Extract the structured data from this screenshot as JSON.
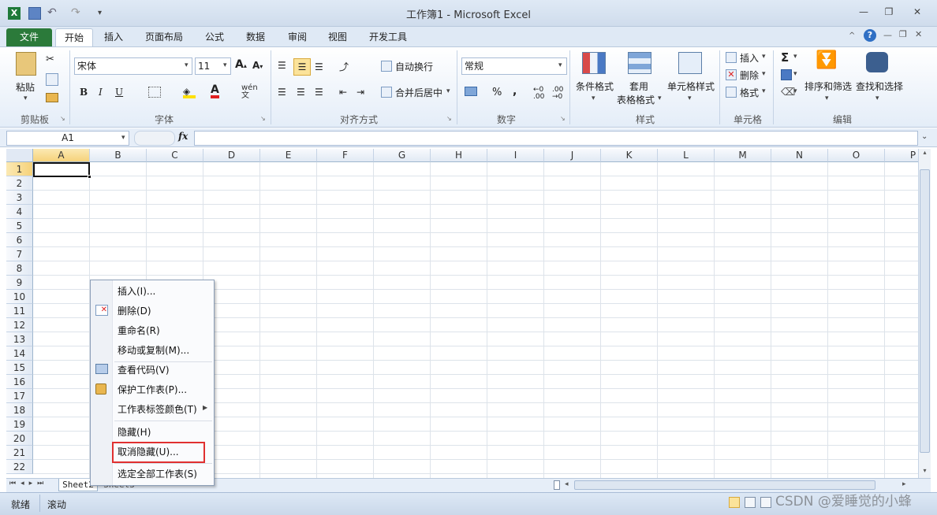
{
  "window": {
    "title": "工作簿1 - Microsoft Excel"
  },
  "ribbon_tabs": [
    "文件",
    "开始",
    "插入",
    "页面布局",
    "公式",
    "数据",
    "审阅",
    "视图",
    "开发工具"
  ],
  "clipboard": {
    "paste": "粘贴",
    "group": "剪贴板"
  },
  "font": {
    "name": "宋体",
    "size": "11",
    "group": "字体"
  },
  "alignment": {
    "wrap": "自动换行",
    "merge": "合并后居中",
    "group": "对齐方式"
  },
  "number": {
    "format": "常规",
    "group": "数字"
  },
  "styles": {
    "conditional": "条件格式",
    "table_a": "套用",
    "table_b": "表格格式",
    "cell_styles": "单元格样式",
    "group": "样式"
  },
  "cells": {
    "insert": "插入",
    "delete": "删除",
    "format": "格式",
    "group": "单元格"
  },
  "editing": {
    "sort": "排序和筛选",
    "find": "查找和选择",
    "group": "编辑"
  },
  "formula_bar": {
    "cell_ref": "A1",
    "fx": "fx"
  },
  "columns": [
    "A",
    "B",
    "C",
    "D",
    "E",
    "F",
    "G",
    "H",
    "I",
    "J",
    "K",
    "L",
    "M",
    "N",
    "O",
    "P"
  ],
  "rows": [
    "1",
    "2",
    "3",
    "4",
    "5",
    "6",
    "7",
    "8",
    "9",
    "10",
    "11",
    "12",
    "13",
    "14",
    "15",
    "16",
    "17",
    "18",
    "19",
    "20",
    "21",
    "22"
  ],
  "sheet_tabs": [
    "Sheet2",
    "Sheet3"
  ],
  "status": {
    "ready": "就绪",
    "scroll": "滚动"
  },
  "context_menu": {
    "items": [
      "插入(I)...",
      "删除(D)",
      "重命名(R)",
      "移动或复制(M)...",
      "查看代码(V)",
      "保护工作表(P)...",
      "工作表标签颜色(T)",
      "隐藏(H)",
      "取消隐藏(U)...",
      "选定全部工作表(S)"
    ],
    "highlighted": "取消隐藏(U)..."
  },
  "watermark": "CSDN @爱睡觉的小蜂",
  "colors": {
    "file_tab": "#2b7a3a",
    "highlight_border": "#e03030",
    "ribbon_bg": "#e4edf8"
  }
}
